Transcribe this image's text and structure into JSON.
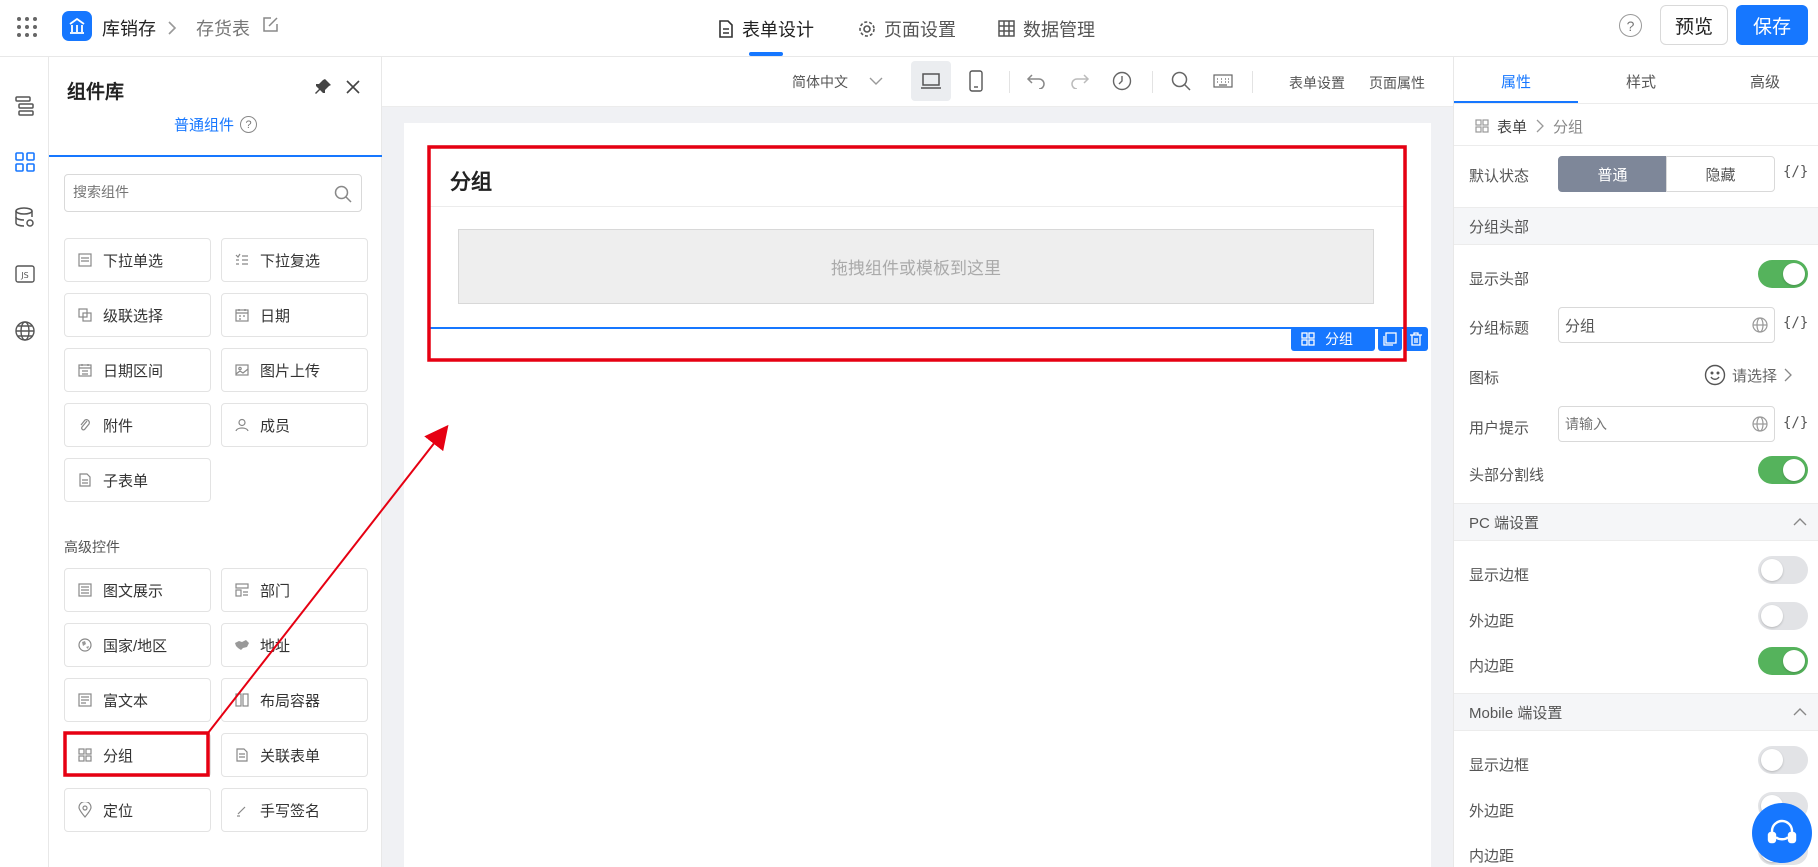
{
  "header": {
    "app_name": "库销存",
    "breadcrumb_sep": ">",
    "page_name": "存货表",
    "tabs": [
      {
        "label": "表单设计",
        "active": true
      },
      {
        "label": "页面设置",
        "active": false
      },
      {
        "label": "数据管理",
        "active": false
      }
    ],
    "help": "?",
    "preview_label": "预览",
    "save_label": "保存"
  },
  "library": {
    "title": "组件库",
    "tab_label": "普通组件",
    "tab_help": "?",
    "search_placeholder": "搜索组件",
    "basic_items": [
      "下拉单选",
      "下拉复选",
      "级联选择",
      "日期",
      "日期区间",
      "图片上传",
      "附件",
      "成员",
      "子表单"
    ],
    "advanced_title": "高级控件",
    "advanced_items": [
      "图文展示",
      "部门",
      "国家/地区",
      "地址",
      "富文本",
      "布局容器",
      "分组",
      "关联表单",
      "定位",
      "手写签名"
    ]
  },
  "toolbar": {
    "language": "简体中文",
    "form_settings": "表单设置",
    "page_props": "页面属性"
  },
  "canvas": {
    "group_title": "分组",
    "drop_hint": "拖拽组件或模板到这里",
    "selected_label": "分组"
  },
  "props": {
    "tabs": [
      "属性",
      "样式",
      "高级"
    ],
    "breadcrumb_root": "表单",
    "breadcrumb_current": "分组",
    "default_state_label": "默认状态",
    "state_normal": "普通",
    "state_hidden": "隐藏",
    "expr": "{/}",
    "section_header": "分组头部",
    "show_header_label": "显示头部",
    "show_header": true,
    "group_title_label": "分组标题",
    "group_title_value": "分组",
    "icon_label": "图标",
    "icon_select": "请选择",
    "hint_label": "用户提示",
    "hint_placeholder": "请输入",
    "header_divider_label": "头部分割线",
    "header_divider": true,
    "section_pc": "PC 端设置",
    "pc": {
      "border_label": "显示边框",
      "border": false,
      "margin_label": "外边距",
      "margin": false,
      "padding_label": "内边距",
      "padding": true
    },
    "section_mobile": "Mobile 端设置",
    "mobile": {
      "border_label": "显示边框",
      "border": false,
      "margin_label": "外边距",
      "padding_label": "内边距"
    }
  },
  "colors": {
    "primary": "#1677ff",
    "toggle_on": "#55b35c",
    "annotation": "#e60012"
  }
}
